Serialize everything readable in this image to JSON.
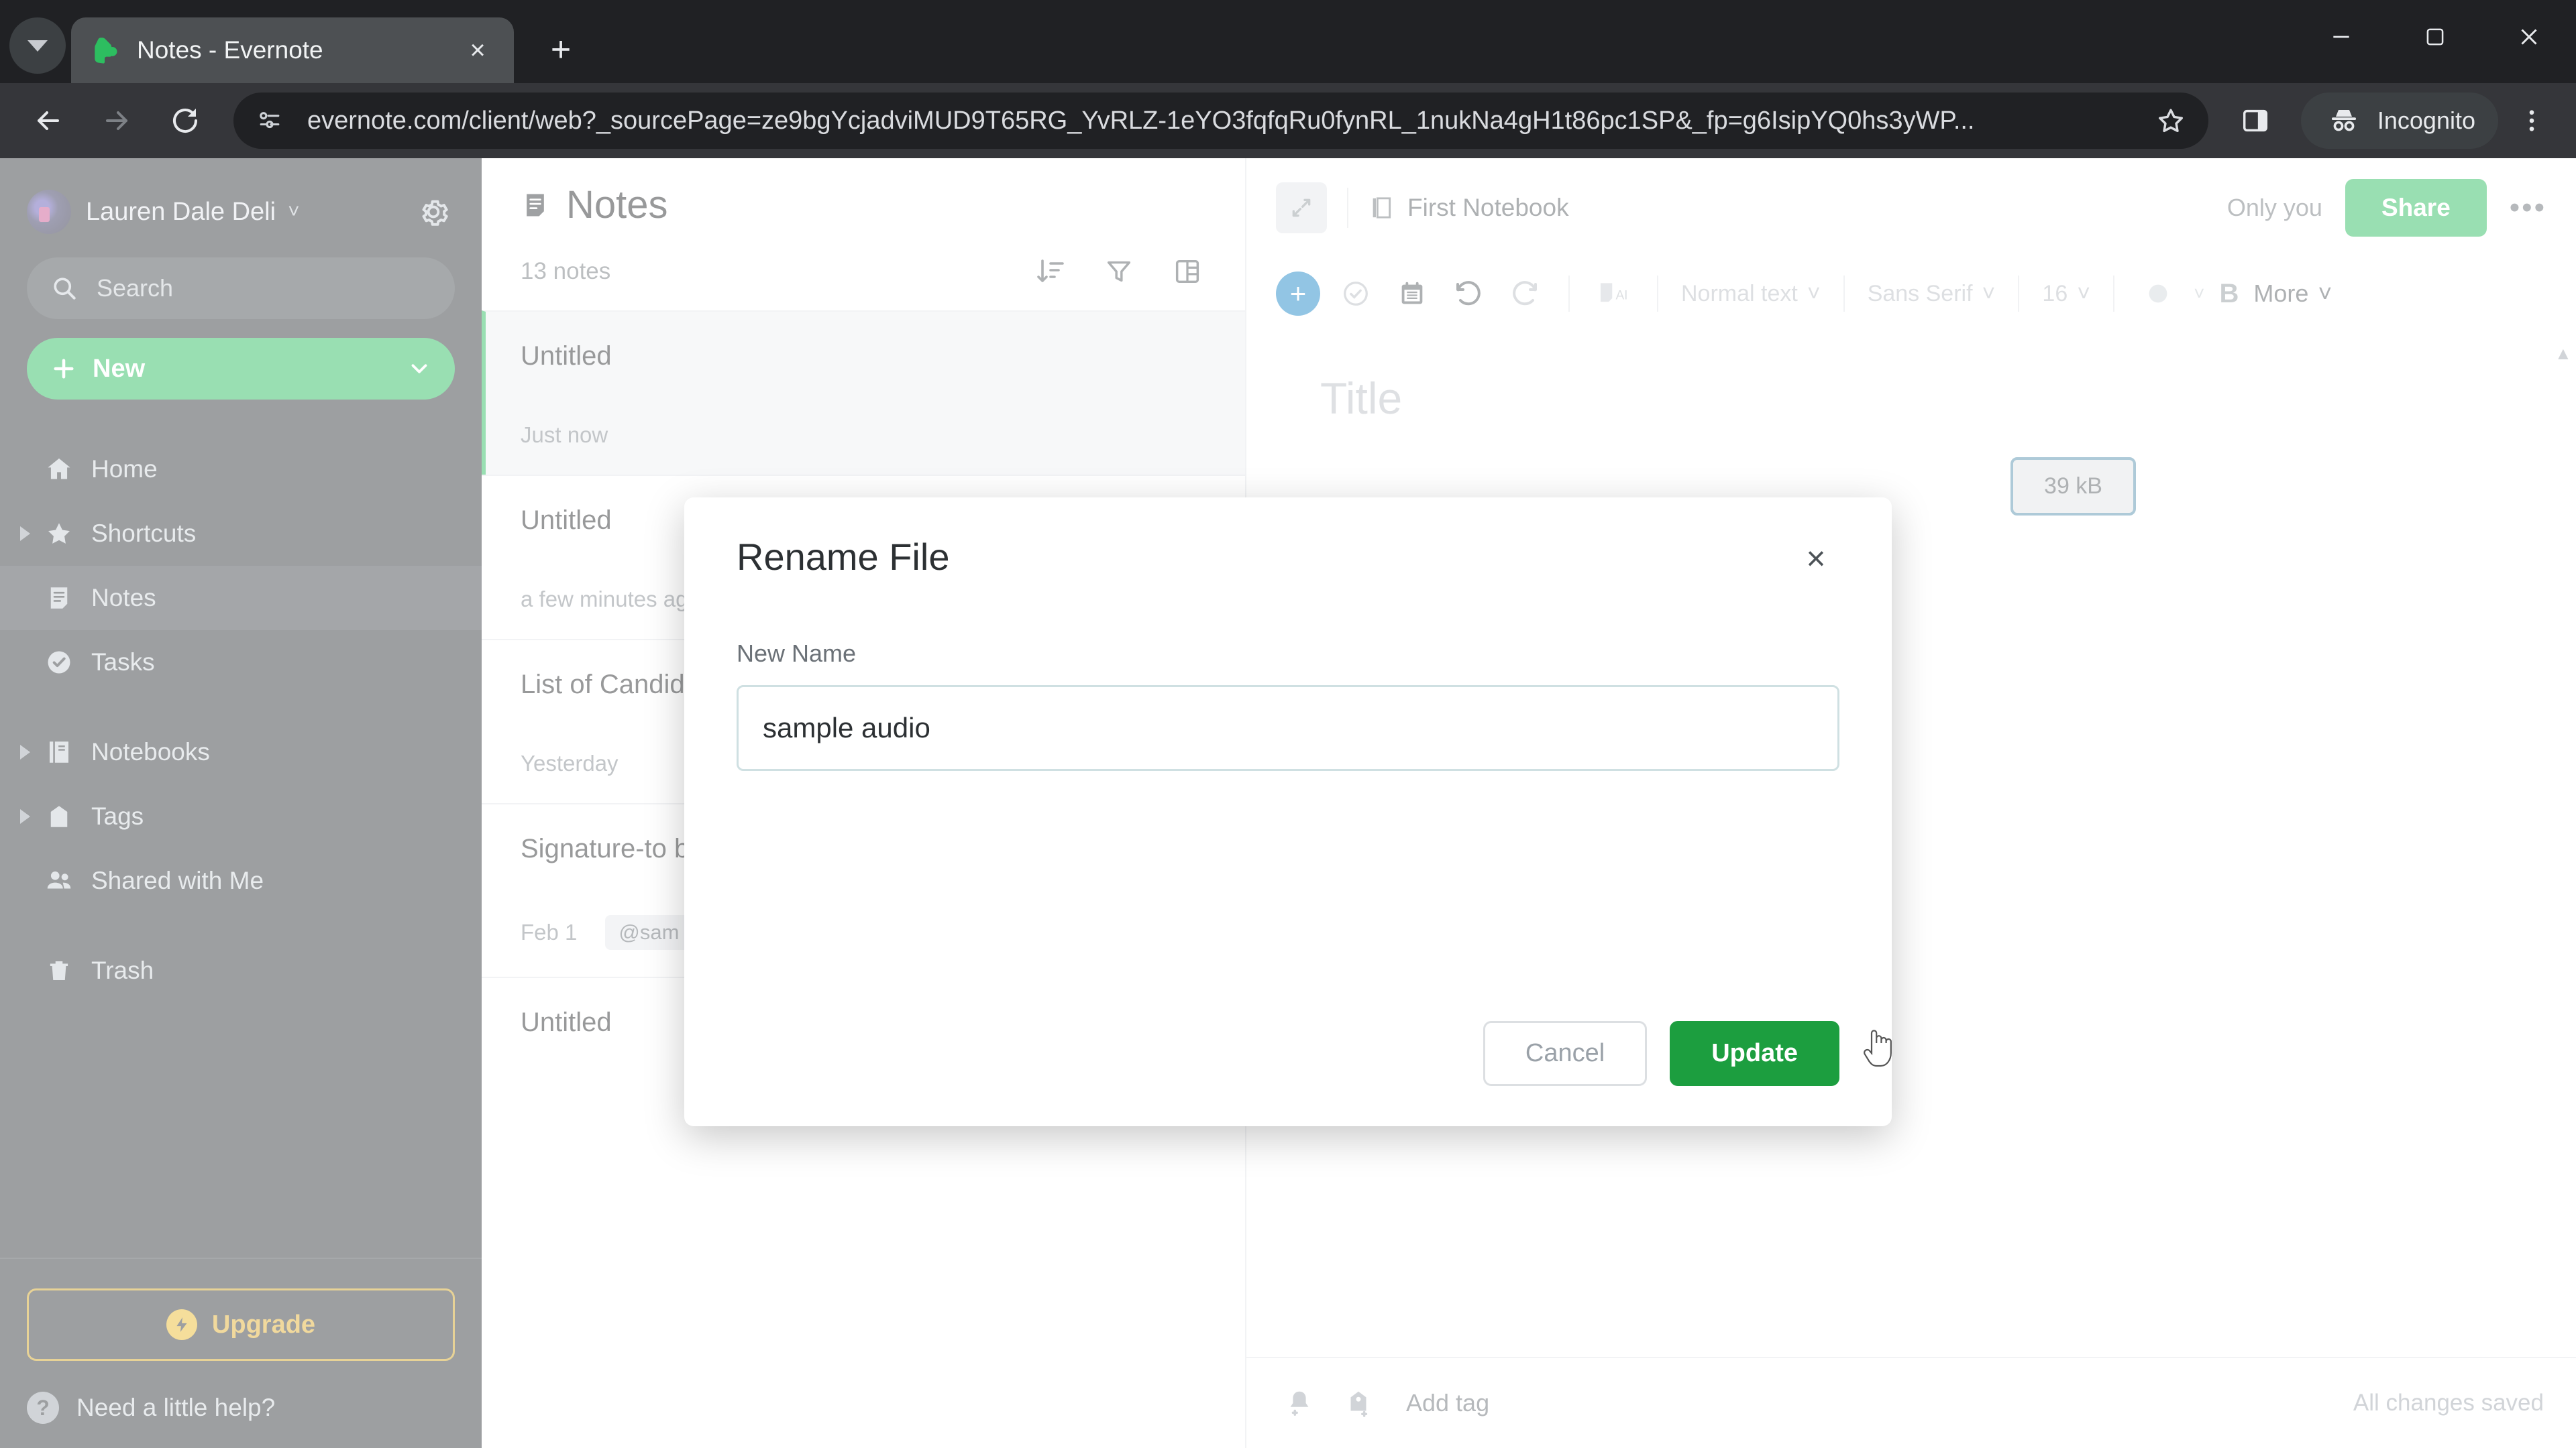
{
  "browser": {
    "tab": {
      "title": "Notes - Evernote",
      "favicon": "evernote-elephant-icon",
      "close_label": "×"
    },
    "new_tab_label": "+",
    "tab_search_icon": "chevron-down-icon",
    "window_controls": {
      "minimize": "–",
      "maximize": "❐",
      "close": "×"
    },
    "nav": {
      "back": "back-arrow-icon",
      "forward": "forward-arrow-icon",
      "reload": "reload-icon"
    },
    "omnibox": {
      "site_info_icon": "site-settings-icon",
      "url": "evernote.com/client/web?_sourcePage=ze9bgYcjadviMUD9T65RG_YvRLZ-1eYO3fqfqRu0fynRL_1nukNa4gH1t86pc1SP&_fp=g6IsipYQ0hs3yWP...",
      "bookmark_icon": "star-icon"
    },
    "side_panel_icon": "side-panel-icon",
    "profile": {
      "label": "Incognito",
      "icon": "incognito-hat-icon"
    },
    "menu_icon": "three-dot-menu-icon"
  },
  "sidebar": {
    "account": {
      "name": "Lauren Dale Deli",
      "caret": "˅",
      "avatar": "user-avatar",
      "settings_icon": "gear-icon"
    },
    "search": {
      "placeholder": "Search",
      "icon": "search-icon"
    },
    "new_button": {
      "label": "New",
      "plus": "+",
      "caret": "˅"
    },
    "items": [
      {
        "label": "Home",
        "icon": "home-icon",
        "expandable": false,
        "active": false
      },
      {
        "label": "Shortcuts",
        "icon": "star-icon",
        "expandable": true,
        "active": false
      },
      {
        "label": "Notes",
        "icon": "notes-icon",
        "expandable": false,
        "active": true
      },
      {
        "label": "Tasks",
        "icon": "task-check-icon",
        "expandable": false,
        "active": false
      },
      {
        "label": "Notebooks",
        "icon": "notebook-icon",
        "expandable": true,
        "active": false
      },
      {
        "label": "Tags",
        "icon": "tag-icon",
        "expandable": true,
        "active": false
      },
      {
        "label": "Shared with Me",
        "icon": "people-icon",
        "expandable": false,
        "active": false
      },
      {
        "label": "Trash",
        "icon": "trash-icon",
        "expandable": false,
        "active": false
      }
    ],
    "upgrade": {
      "label": "Upgrade",
      "icon": "bolt-icon"
    },
    "help": {
      "label": "Need a little help?",
      "icon": "question-circle-icon"
    }
  },
  "note_list": {
    "title": "Notes",
    "title_icon": "notes-icon",
    "count_label": "13 notes",
    "tools": [
      {
        "name": "sort-icon",
        "glyph": "sort"
      },
      {
        "name": "filter-icon",
        "glyph": "filter"
      },
      {
        "name": "view-layout-icon",
        "glyph": "layout"
      }
    ],
    "notes": [
      {
        "name": "Untitled",
        "date": "Just now",
        "tag": "",
        "thumb": false,
        "selected": true
      },
      {
        "name": "Untitled",
        "date": "a few minutes ago",
        "tag": "",
        "thumb": false,
        "selected": false
      },
      {
        "name": "List of Candidates",
        "date": "Yesterday",
        "tag": "",
        "thumb": false,
        "selected": false
      },
      {
        "name": "Signature-to be attached",
        "date": "Feb 1",
        "tag": "@sam",
        "thumb": true,
        "selected": false
      },
      {
        "name": "Untitled",
        "date": "",
        "tag": "",
        "thumb": false,
        "selected": false
      }
    ]
  },
  "editor": {
    "expand_icon": "expand-note-icon",
    "notebook": {
      "label": "First Notebook",
      "icon": "notebook-icon"
    },
    "only_you": "Only you",
    "share_label": "Share",
    "more_glyph": "•••",
    "toolbar": {
      "plus": "+",
      "items": [
        {
          "name": "task-check-icon"
        },
        {
          "name": "calendar-icon"
        },
        {
          "name": "undo-icon"
        },
        {
          "name": "redo-icon"
        },
        {
          "name": "ai-icon",
          "label": "AI"
        }
      ],
      "paragraph_style": "Normal text",
      "font_family": "Sans Serif",
      "font_size": "16",
      "color_icon": "text-color-icon",
      "bold_label": "B",
      "more_label": "More"
    },
    "title_placeholder": "Title",
    "attachment_size": "39 kB",
    "status": {
      "reminder_icon": "add-reminder-icon",
      "tag_icon": "add-tag-icon",
      "add_tag_label": "Add tag",
      "saved_label": "All changes saved"
    }
  },
  "modal": {
    "title": "Rename File",
    "close_glyph": "×",
    "field_label": "New Name",
    "field_value": "sample audio",
    "cancel_label": "Cancel",
    "update_label": "Update"
  },
  "colors": {
    "evernote_green": "#1eb955",
    "update_green": "#1c9e3f",
    "upgrade_gold": "#e0aa26",
    "accent_blue": "#0f7fc4"
  }
}
